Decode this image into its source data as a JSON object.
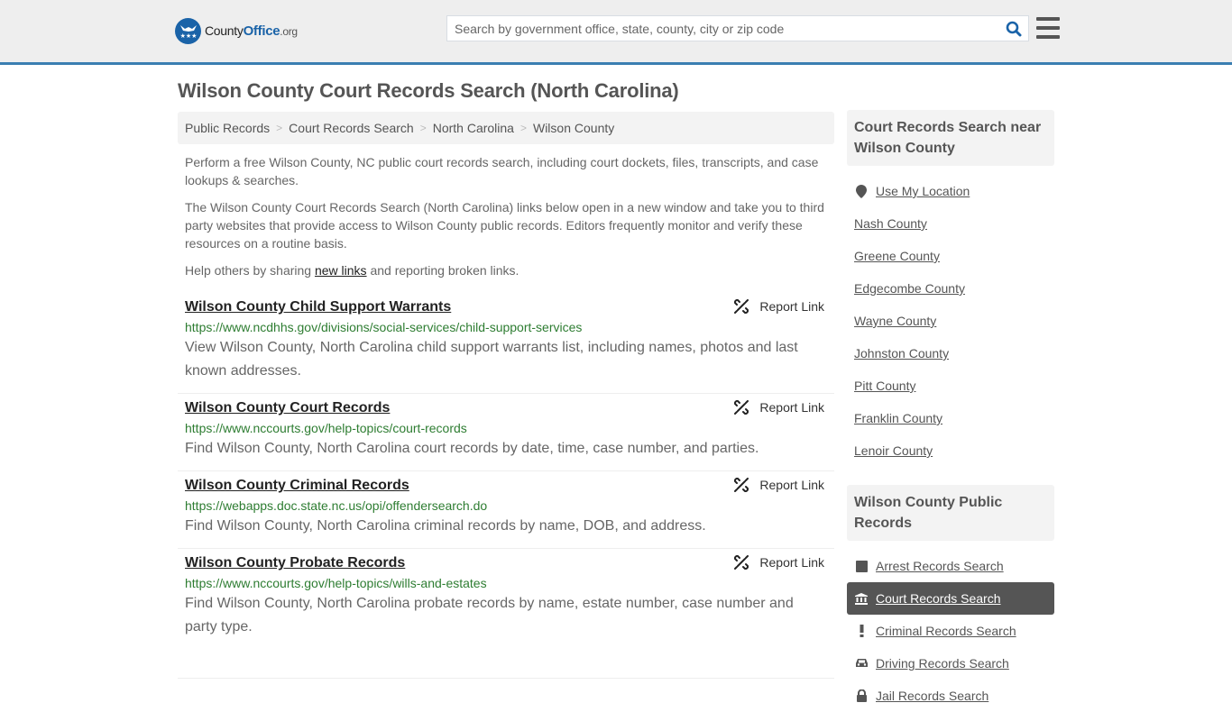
{
  "header": {
    "logo": {
      "county": "County",
      "office": "Office",
      "tld": ".org"
    },
    "search_placeholder": "Search by government office, state, county, city or zip code",
    "brand_color": "#1a63a8",
    "accent_border": "#3a7eb1"
  },
  "page": {
    "title": "Wilson County Court Records Search (North Carolina)",
    "breadcrumb": [
      "Public Records",
      "Court Records Search",
      "North Carolina",
      "Wilson County"
    ],
    "intro": {
      "p1": "Perform a free Wilson County, NC public court records search, including court dockets, files, transcripts, and case lookups & searches.",
      "p2": "The Wilson County Court Records Search (North Carolina) links below open in a new window and take you to third party websites that provide access to Wilson County public records. Editors frequently monitor and verify these resources on a routine basis.",
      "p3_before": "Help others by sharing ",
      "p3_link": "new links",
      "p3_after": " and reporting broken links."
    }
  },
  "results": [
    {
      "title": "Wilson County Child Support Warrants",
      "url": "https://www.ncdhhs.gov/divisions/social-services/child-support-services",
      "description": "View Wilson County, North Carolina child support warrants list, including names, photos and last known addresses.",
      "report_label": "Report Link"
    },
    {
      "title": "Wilson County Court Records",
      "url": "https://www.nccourts.gov/help-topics/court-records",
      "description": "Find Wilson County, North Carolina court records by date, time, case number, and parties.",
      "report_label": "Report Link"
    },
    {
      "title": "Wilson County Criminal Records",
      "url": "https://webapps.doc.state.nc.us/opi/offendersearch.do",
      "description": "Find Wilson County, North Carolina criminal records by name, DOB, and address.",
      "report_label": "Report Link"
    },
    {
      "title": "Wilson County Probate Records",
      "url": "https://www.nccourts.gov/help-topics/wills-and-estates",
      "description": "Find Wilson County, North Carolina probate records by name, estate number, case number and party type.",
      "report_label": "Report Link"
    }
  ],
  "sidebar": {
    "nearby": {
      "heading": "Court Records Search near Wilson County",
      "use_location": "Use My Location",
      "counties": [
        "Nash County",
        "Greene County",
        "Edgecombe County",
        "Wayne County",
        "Johnston County",
        "Pitt County",
        "Franklin County",
        "Lenoir County"
      ]
    },
    "public_records": {
      "heading": "Wilson County Public Records",
      "items": [
        {
          "label": "Arrest Records Search",
          "icon": "square-icon",
          "active": false
        },
        {
          "label": "Court Records Search",
          "icon": "courthouse-icon",
          "active": true
        },
        {
          "label": "Criminal Records Search",
          "icon": "exclamation-icon",
          "active": false
        },
        {
          "label": "Driving Records Search",
          "icon": "car-icon",
          "active": false
        },
        {
          "label": "Jail Records Search",
          "icon": "lock-icon",
          "active": false
        }
      ]
    }
  }
}
